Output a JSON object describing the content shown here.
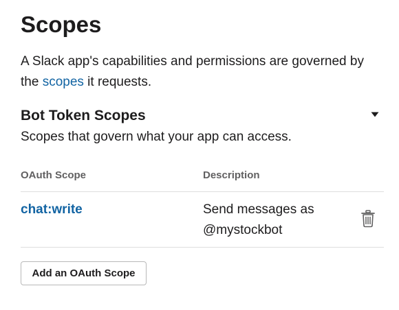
{
  "page": {
    "title": "Scopes",
    "intro_before": "A Slack app's capabilities and permissions are governed by the ",
    "intro_link": "scopes",
    "intro_after": " it requests."
  },
  "section": {
    "title": "Bot Token Scopes",
    "subtitle": "Scopes that govern what your app can access.",
    "collapse_icon": "caret-down-icon"
  },
  "table": {
    "headers": {
      "scope": "OAuth Scope",
      "description": "Description"
    },
    "rows": [
      {
        "scope": "chat:write",
        "description": "Send messages as @mystockbot",
        "action_icon": "trash-icon"
      }
    ]
  },
  "actions": {
    "add_scope_label": "Add an OAuth Scope"
  },
  "colors": {
    "link": "#1264a3",
    "text": "#1d1c1d",
    "muted": "#616061",
    "divider": "#dddddd"
  }
}
